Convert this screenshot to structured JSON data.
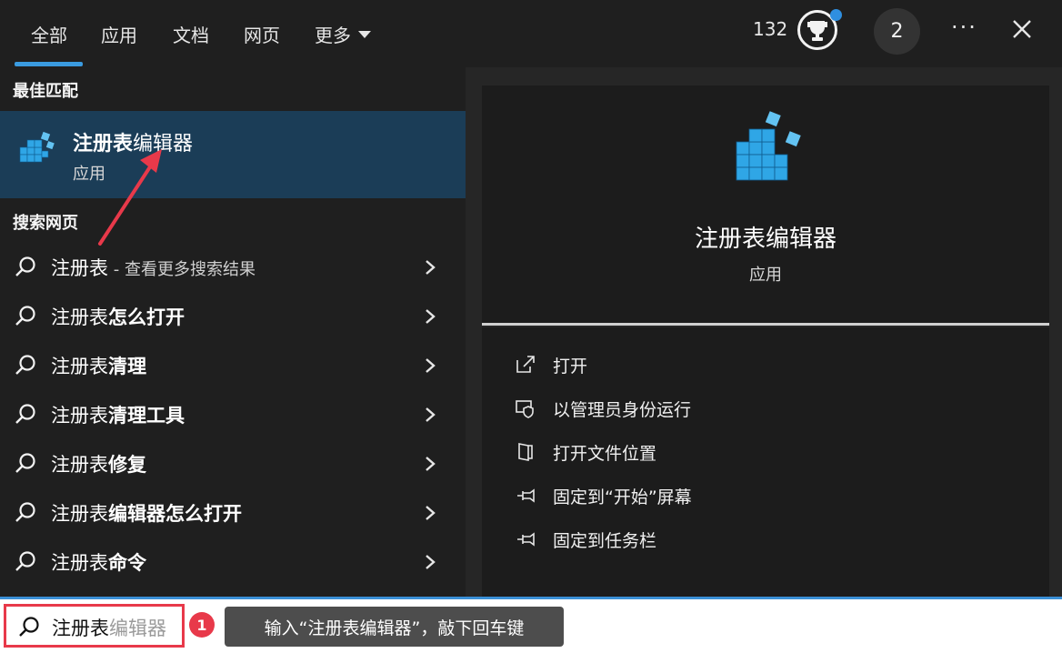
{
  "tabs": [
    {
      "label": "全部",
      "active": true
    },
    {
      "label": "应用"
    },
    {
      "label": "文档"
    },
    {
      "label": "网页"
    },
    {
      "label": "更多"
    }
  ],
  "header": {
    "points": "132",
    "avatar_letter": "2",
    "more_label": "···",
    "trophy_icon": "trophy-icon",
    "close_icon": "close-icon"
  },
  "best_match": {
    "section_title": "最佳匹配",
    "title_bold": "注册表",
    "title_rest": "编辑器",
    "subtitle": "应用",
    "icon": "registry-editor-icon"
  },
  "web_search": {
    "section_title": "搜索网页",
    "items": [
      {
        "prefix": "注册表",
        "bold": "",
        "hint": " - 查看更多搜索结果"
      },
      {
        "prefix": "注册表",
        "bold": "怎么打开",
        "hint": ""
      },
      {
        "prefix": "注册表",
        "bold": "清理",
        "hint": ""
      },
      {
        "prefix": "注册表",
        "bold": "清理工具",
        "hint": ""
      },
      {
        "prefix": "注册表",
        "bold": "修复",
        "hint": ""
      },
      {
        "prefix": "注册表",
        "bold": "编辑器怎么打开",
        "hint": ""
      },
      {
        "prefix": "注册表",
        "bold": "命令",
        "hint": ""
      }
    ]
  },
  "detail": {
    "title": "注册表编辑器",
    "subtitle": "应用",
    "actions": [
      {
        "label": "打开",
        "icon": "open-external-icon"
      },
      {
        "label": "以管理员身份运行",
        "icon": "shield-run-as-admin-icon"
      },
      {
        "label": "打开文件位置",
        "icon": "file-location-icon"
      },
      {
        "label": "固定到“开始”屏幕",
        "icon": "pin-icon"
      },
      {
        "label": "固定到任务栏",
        "icon": "pin-icon"
      }
    ]
  },
  "search": {
    "typed": "注册表",
    "suggestion": "编辑器",
    "step_number": "1",
    "tooltip": "输入“注册表编辑器”，敲下回车键"
  },
  "colors": {
    "accent": "#3a9be0",
    "selection": "#1b3d57",
    "annotation_red": "#e8394a"
  }
}
